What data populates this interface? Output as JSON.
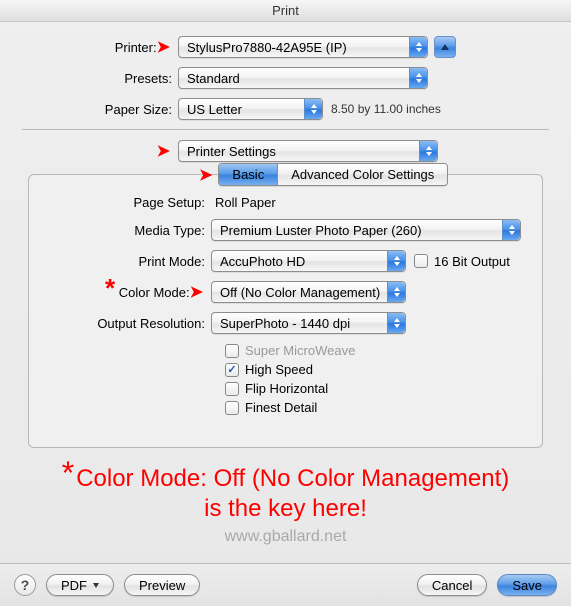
{
  "window": {
    "title": "Print"
  },
  "top": {
    "printer_label": "Printer:",
    "printer_value": "StylusPro7880-42A95E (IP)",
    "presets_label": "Presets:",
    "presets_value": "Standard",
    "papersize_label": "Paper Size:",
    "papersize_value": "US Letter",
    "papersize_dim": "8.50 by 11.00 inches",
    "section_value": "Printer Settings"
  },
  "tabs": {
    "basic": "Basic",
    "advanced": "Advanced Color Settings"
  },
  "settings": {
    "page_setup_label": "Page Setup:",
    "page_setup_value": "Roll Paper",
    "media_type_label": "Media Type:",
    "media_type_value": "Premium Luster Photo Paper (260)",
    "print_mode_label": "Print Mode:",
    "print_mode_value": "AccuPhoto HD",
    "sixteen_bit_label": "16 Bit Output",
    "color_mode_label": "Color Mode:",
    "color_mode_value": "Off (No Color Management)",
    "output_res_label": "Output Resolution:",
    "output_res_value": "SuperPhoto - 1440 dpi",
    "chk_super_microweave": "Super MicroWeave",
    "chk_high_speed": "High Speed",
    "chk_flip": "Flip Horizontal",
    "chk_finest": "Finest Detail"
  },
  "callout": {
    "line1": "Color Mode: Off (No Color Management)",
    "line2": "is the key here!"
  },
  "watermark": "www.gballard.net",
  "footer": {
    "help": "?",
    "pdf": "PDF",
    "preview": "Preview",
    "cancel": "Cancel",
    "save": "Save"
  }
}
